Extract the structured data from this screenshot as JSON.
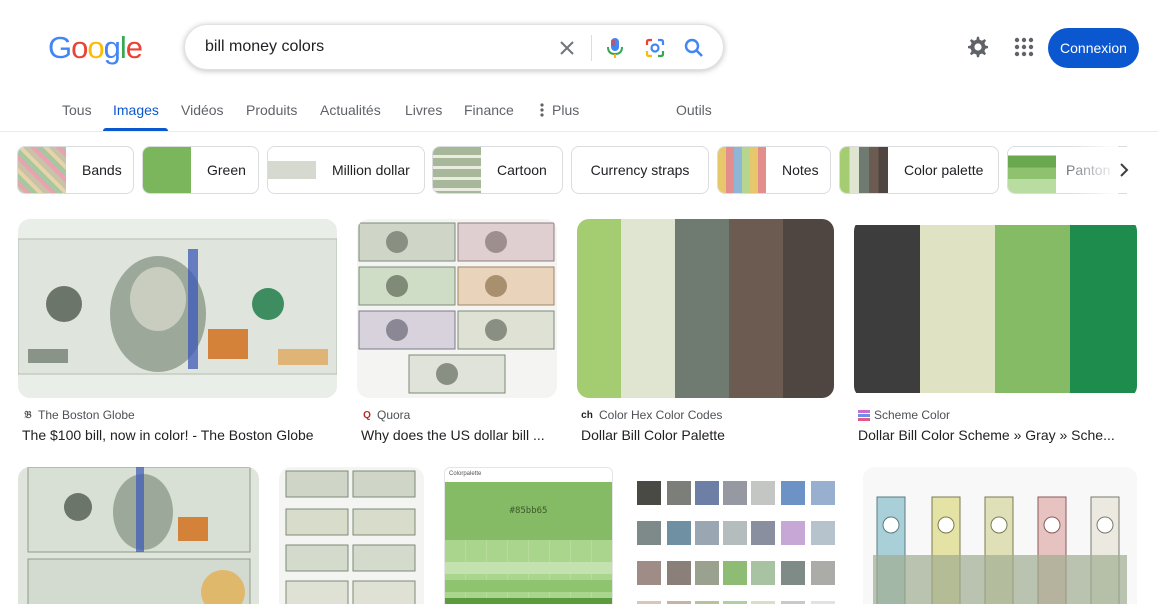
{
  "brand": {
    "logo_letters": [
      "G",
      "o",
      "o",
      "g",
      "l",
      "e"
    ],
    "logo_colors": [
      "#4285f4",
      "#ea4335",
      "#fbbc05",
      "#4285f4",
      "#34a853",
      "#ea4335"
    ]
  },
  "search": {
    "query": "bill money colors"
  },
  "header": {
    "settings_icon": "gear-icon",
    "apps_icon": "apps-grid-icon",
    "signin_label": "Connexion"
  },
  "tabs": [
    {
      "label": "Tous"
    },
    {
      "label": "Images"
    },
    {
      "label": "Vidéos"
    },
    {
      "label": "Produits"
    },
    {
      "label": "Actualités"
    },
    {
      "label": "Livres"
    },
    {
      "label": "Finance"
    },
    {
      "label": "Plus"
    },
    {
      "label": "Outils"
    }
  ],
  "chips": [
    {
      "label": "Bands"
    },
    {
      "label": "Green"
    },
    {
      "label": "Million dollar"
    },
    {
      "label": "Cartoon"
    },
    {
      "label": "Currency straps"
    },
    {
      "label": "Notes"
    },
    {
      "label": "Color palette"
    },
    {
      "label": "Panton"
    }
  ],
  "results": [
    {
      "source": "The Boston Globe",
      "title": "The $100 bill, now in color! - The Boston Globe"
    },
    {
      "source": "Quora",
      "title": "Why does the US dollar bill ..."
    },
    {
      "source": "Color Hex Color Codes",
      "title": "Dollar Bill Color Palette"
    },
    {
      "source": "Scheme Color",
      "title": "Dollar Bill Color Scheme » Gray » Sche..."
    }
  ],
  "palette_image_text": {
    "site": "Colorpalette",
    "hex": "#85bb65"
  },
  "colors": {
    "accent_blue": "#0b57d0",
    "palette_1": [
      "#a4cd72",
      "#dfe5d0",
      "#6f7a70",
      "#6c5b51",
      "#4f4541"
    ],
    "palette_2": [
      "#3d3d3d",
      "#dfe3c3",
      "#85bb65",
      "#1e8c4c"
    ]
  }
}
